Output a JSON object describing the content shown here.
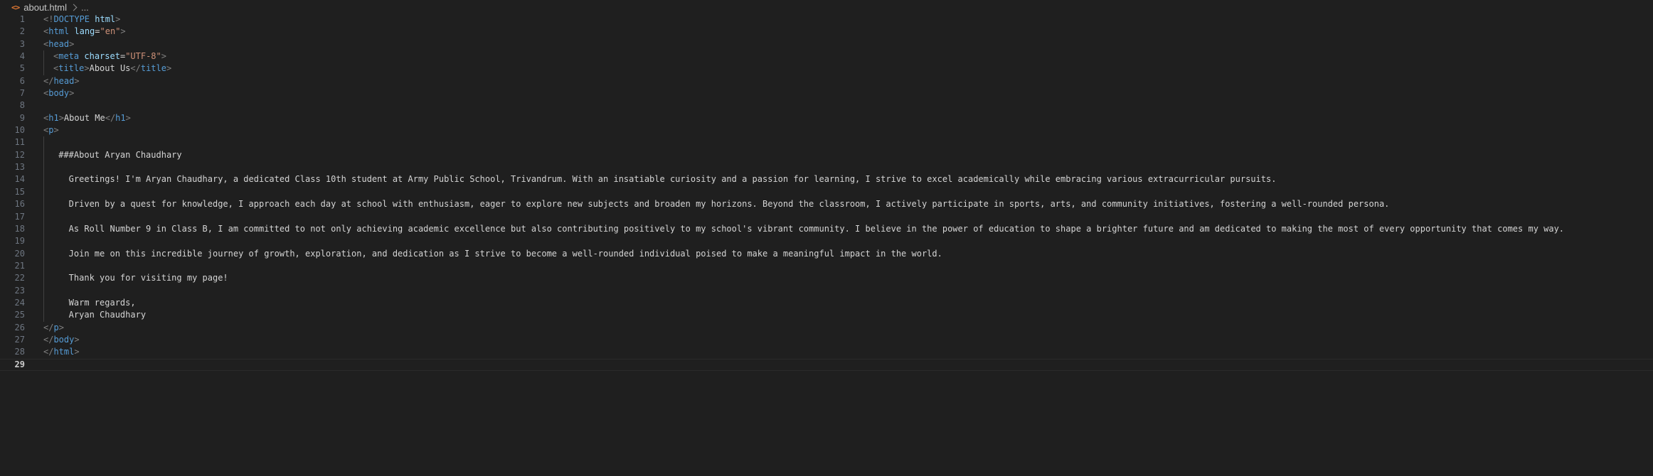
{
  "breadcrumb": {
    "icon": "html-file-icon",
    "file": "about.html",
    "more": "..."
  },
  "current_line": 29,
  "lines": [
    {
      "num": "1",
      "parts": [
        [
          "t",
          "<!"
        ],
        [
          "n",
          "DOCTYPE "
        ],
        [
          "a",
          "html"
        ],
        [
          "t",
          ">"
        ]
      ]
    },
    {
      "num": "2",
      "parts": [
        [
          "t",
          "<"
        ],
        [
          "n",
          "html"
        ],
        [
          "x",
          " "
        ],
        [
          "a",
          "lang"
        ],
        [
          "x",
          "="
        ],
        [
          "s",
          "\"en\""
        ],
        [
          "t",
          ">"
        ]
      ]
    },
    {
      "num": "3",
      "parts": [
        [
          "t",
          "<"
        ],
        [
          "n",
          "head"
        ],
        [
          "t",
          ">"
        ]
      ]
    },
    {
      "num": "4",
      "indent": 1,
      "parts": [
        [
          "t",
          "<"
        ],
        [
          "n",
          "meta"
        ],
        [
          "x",
          " "
        ],
        [
          "a",
          "charset"
        ],
        [
          "x",
          "="
        ],
        [
          "s",
          "\"UTF-8\""
        ],
        [
          "t",
          ">"
        ]
      ]
    },
    {
      "num": "5",
      "indent": 1,
      "parts": [
        [
          "t",
          "<"
        ],
        [
          "n",
          "title"
        ],
        [
          "t",
          ">"
        ],
        [
          "x",
          "About Us"
        ],
        [
          "t",
          "</"
        ],
        [
          "n",
          "title"
        ],
        [
          "t",
          ">"
        ]
      ]
    },
    {
      "num": "6",
      "parts": [
        [
          "t",
          "</"
        ],
        [
          "n",
          "head"
        ],
        [
          "t",
          ">"
        ]
      ]
    },
    {
      "num": "7",
      "parts": [
        [
          "t",
          "<"
        ],
        [
          "n",
          "body"
        ],
        [
          "t",
          ">"
        ]
      ]
    },
    {
      "num": "8",
      "parts": []
    },
    {
      "num": "9",
      "parts": [
        [
          "t",
          "<"
        ],
        [
          "n",
          "h1"
        ],
        [
          "t",
          ">"
        ],
        [
          "x",
          "About Me"
        ],
        [
          "t",
          "</"
        ],
        [
          "n",
          "h1"
        ],
        [
          "t",
          ">"
        ]
      ]
    },
    {
      "num": "10",
      "parts": [
        [
          "t",
          "<"
        ],
        [
          "n",
          "p"
        ],
        [
          "t",
          ">"
        ]
      ]
    },
    {
      "num": "11",
      "indent": 1,
      "parts": []
    },
    {
      "num": "12",
      "indent": 1,
      "parts": [
        [
          "x",
          " ###About Aryan Chaudhary"
        ]
      ]
    },
    {
      "num": "13",
      "indent": 1,
      "parts": []
    },
    {
      "num": "14",
      "indent": 1,
      "parts": [
        [
          "x",
          "   Greetings! I'm Aryan Chaudhary, a dedicated Class 10th student at Army Public School, Trivandrum. With an insatiable curiosity and a passion for learning, I strive to excel academically while embracing various extracurricular pursuits."
        ]
      ]
    },
    {
      "num": "15",
      "indent": 1,
      "parts": []
    },
    {
      "num": "16",
      "indent": 1,
      "parts": [
        [
          "x",
          "   Driven by a quest for knowledge, I approach each day at school with enthusiasm, eager to explore new subjects and broaden my horizons. Beyond the classroom, I actively participate in sports, arts, and community initiatives, fostering a well-rounded persona."
        ]
      ]
    },
    {
      "num": "17",
      "indent": 1,
      "parts": []
    },
    {
      "num": "18",
      "indent": 1,
      "parts": [
        [
          "x",
          "   As Roll Number 9 in Class B, I am committed to not only achieving academic excellence but also contributing positively to my school's vibrant community. I believe in the power of education to shape a brighter future and am dedicated to making the most of every opportunity that comes my way."
        ]
      ]
    },
    {
      "num": "19",
      "indent": 1,
      "parts": []
    },
    {
      "num": "20",
      "indent": 1,
      "parts": [
        [
          "x",
          "   Join me on this incredible journey of growth, exploration, and dedication as I strive to become a well-rounded individual poised to make a meaningful impact in the world."
        ]
      ]
    },
    {
      "num": "21",
      "indent": 1,
      "parts": []
    },
    {
      "num": "22",
      "indent": 1,
      "parts": [
        [
          "x",
          "   Thank you for visiting my page!"
        ]
      ]
    },
    {
      "num": "23",
      "indent": 1,
      "parts": []
    },
    {
      "num": "24",
      "indent": 1,
      "parts": [
        [
          "x",
          "   Warm regards,"
        ]
      ]
    },
    {
      "num": "25",
      "indent": 1,
      "parts": [
        [
          "x",
          "   Aryan Chaudhary"
        ]
      ]
    },
    {
      "num": "26",
      "parts": [
        [
          "t",
          "</"
        ],
        [
          "n",
          "p"
        ],
        [
          "t",
          ">"
        ]
      ]
    },
    {
      "num": "27",
      "parts": [
        [
          "t",
          "</"
        ],
        [
          "n",
          "body"
        ],
        [
          "t",
          ">"
        ]
      ]
    },
    {
      "num": "28",
      "parts": [
        [
          "t",
          "</"
        ],
        [
          "n",
          "html"
        ],
        [
          "t",
          ">"
        ]
      ]
    },
    {
      "num": "29",
      "parts": []
    }
  ],
  "colors": {
    "background": "#1f1f1f",
    "tag_punctuation": "#808080",
    "tag_name": "#569cd6",
    "attribute": "#9cdcfe",
    "string": "#ce9178",
    "text": "#d4d4d4",
    "line_number": "#6e7681",
    "file_icon": "#e37933"
  }
}
